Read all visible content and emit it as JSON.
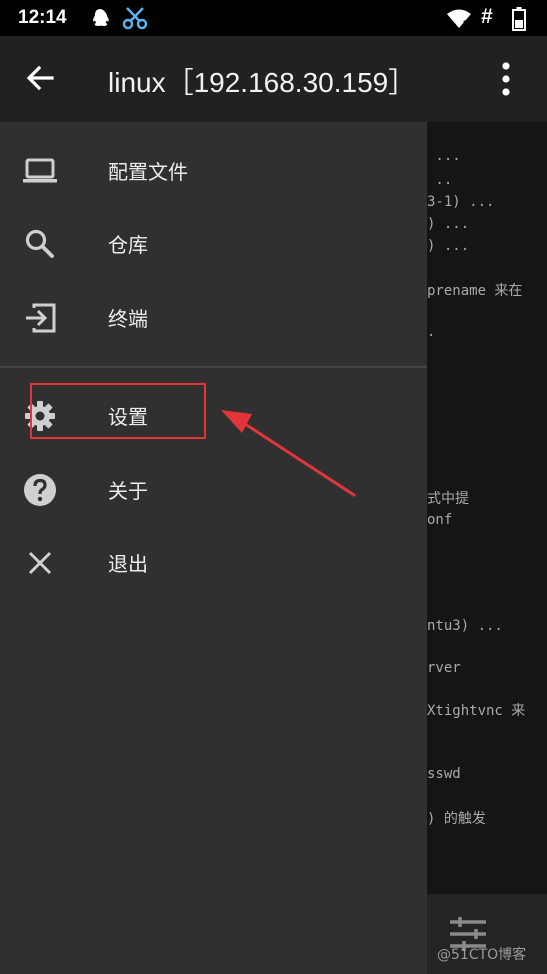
{
  "status_bar": {
    "time": "12:14",
    "icons": [
      "qq-icon",
      "scissors-icon",
      "wifi-icon",
      "hash-icon",
      "battery-icon"
    ],
    "hash_symbol": "#"
  },
  "app_bar": {
    "title": "linux［192.168.30.159］"
  },
  "drawer": {
    "items": [
      {
        "label": "配置文件",
        "icon": "laptop-icon"
      },
      {
        "label": "仓库",
        "icon": "search-icon"
      },
      {
        "label": "终端",
        "icon": "exit-to-app-icon"
      },
      {
        "label": "设置",
        "icon": "gear-icon"
      },
      {
        "label": "关于",
        "icon": "help-icon"
      },
      {
        "label": "退出",
        "icon": "close-icon"
      }
    ]
  },
  "terminal": {
    "lines": [
      " ...",
      " ..",
      "3-1) ...",
      ") ...",
      ") ...",
      "prename 来在",
      ".",
      "式中提",
      "onf",
      "ntu3) ...",
      "rver",
      "Xtightvnc 来",
      "sswd",
      ") 的触发"
    ]
  },
  "watermark": "@51CTO博客",
  "colors": {
    "highlight_border": "#e2353a",
    "arrow": "#e2353a",
    "drawer_background": "#303030",
    "app_bar_background": "#212121"
  }
}
